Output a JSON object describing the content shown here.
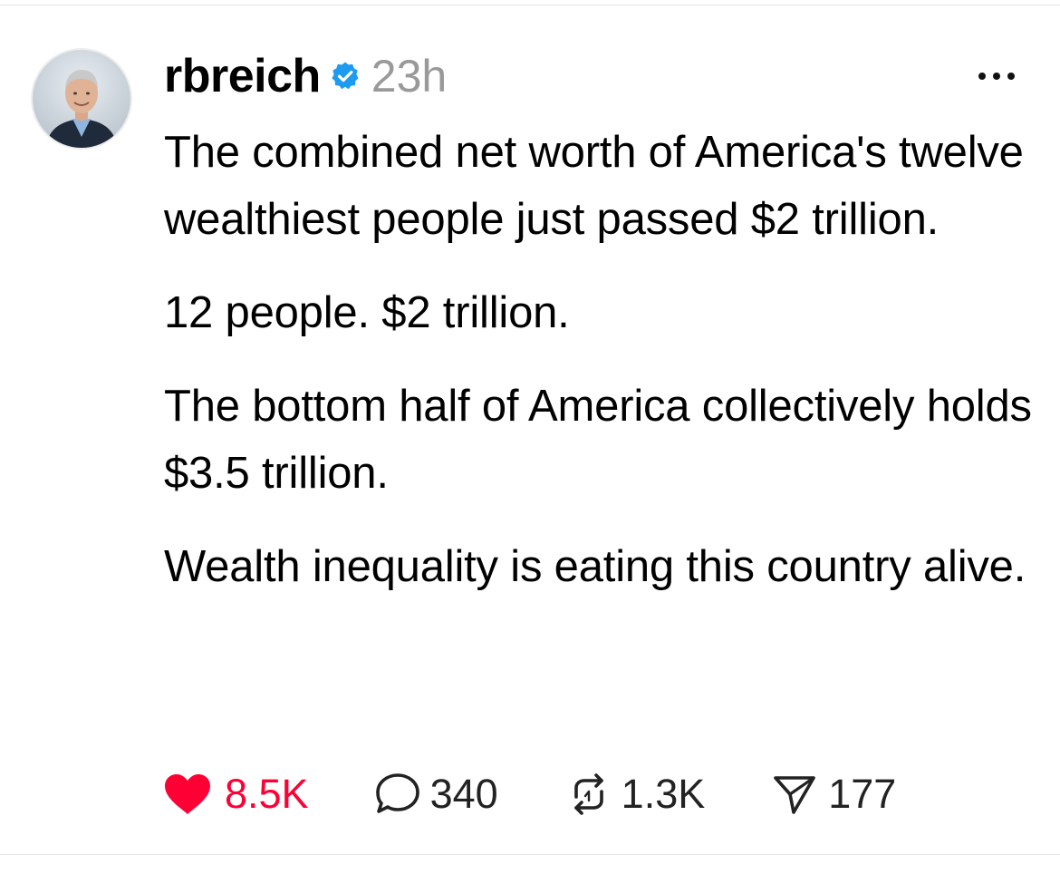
{
  "post": {
    "username": "rbreich",
    "verified": true,
    "timestamp": "23h",
    "paragraphs": [
      "The combined net worth of America's twelve wealthiest people just passed $2 trillion.",
      "12 people. $2 trillion.",
      "The bottom half of America collectively holds $3.5 trillion.",
      "Wealth inequality is eating this country alive."
    ],
    "stats": {
      "likes": "8.5K",
      "replies": "340",
      "reposts": "1.3K",
      "shares": "177"
    }
  },
  "icons": {
    "verified": "verified-badge-icon",
    "more": "more-options-icon",
    "like": "heart-icon",
    "reply": "comment-bubble-icon",
    "repost": "repost-icon",
    "share": "send-icon"
  },
  "colors": {
    "verified": "#1d9bf0",
    "like": "#ff0034",
    "muted": "#999999",
    "text": "#000000"
  }
}
